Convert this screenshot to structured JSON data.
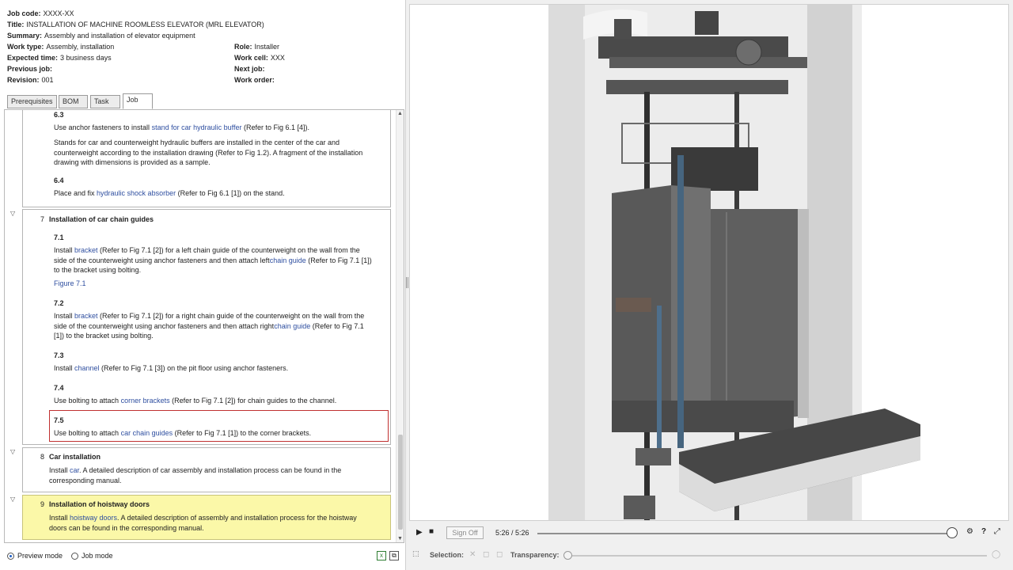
{
  "header": {
    "job_code_label": "Job code:",
    "job_code": "XXXX-XX",
    "title_label": "Title:",
    "title": "INSTALLATION OF MACHINE ROOMLESS ELEVATOR (MRL ELEVATOR)",
    "summary_label": "Summary:",
    "summary": "Assembly and installation of elevator equipment",
    "work_type_label": "Work type:",
    "work_type": "Assembly, installation",
    "expected_time_label": "Expected time:",
    "expected_time": "3 business days",
    "previous_job_label": "Previous job:",
    "revision_label": "Revision:",
    "revision": "001",
    "role_label": "Role:",
    "role": "Installer",
    "work_cell_label": "Work cell:",
    "work_cell": "XXX",
    "next_job_label": "Next job:",
    "work_order_label": "Work order:"
  },
  "tabs": [
    "Prerequisites",
    "BOM",
    "Task",
    "Job"
  ],
  "active_tab": "Job",
  "steps": {
    "step6": {
      "s63_num": "6.3",
      "s63_l1a": "Use anchor fasteners to install ",
      "s63_l1b": "stand for car hydraulic buffer",
      "s63_l1c": " (Refer to Fig 6.1 [4]).",
      "s63_p1": "Stands for car and counterweight hydraulic buffers are installed in the center of the car and",
      "s63_p2": "counterweight according to the installation drawing (Refer to Fig 1.2). A fragment of the installation",
      "s63_p3": "drawing with dimensions is provided as a sample.",
      "s64_num": "6.4",
      "s64_a": "Place and fix ",
      "s64_b": "hydraulic shock absorber",
      "s64_c": " (Refer to Fig 6.1 [1]) on the stand."
    },
    "step7": {
      "number": "7",
      "title": "Installation of car chain guides",
      "s71_num": "7.1",
      "s71_l1a": "Install ",
      "s71_l1b": "bracket",
      "s71_l1c": " (Refer to Fig 7.1 [2]) for a left chain guide of the counterweight on the wall from the",
      "s71_l2a": "side of the counterweight using anchor fasteners and then attach left",
      "s71_l2b": "chain guide",
      "s71_l2c": " (Refer to Fig 7.1 [1])",
      "s71_l3": "to the bracket using bolting.",
      "fig": "Figure 7.1",
      "s72_num": "7.2",
      "s72_l1a": "Install ",
      "s72_l1b": "bracket",
      "s72_l1c": " (Refer to Fig 7.1 [2]) for a right chain guide of the counterweight on the wall from the",
      "s72_l2a": "side of the counterweight using anchor fasteners and then attach right",
      "s72_l2b": "chain guide",
      "s72_l2c": " (Refer to Fig 7.1",
      "s72_l3": "[1]) to the bracket using bolting.",
      "s73_num": "7.3",
      "s73_a": "Install ",
      "s73_b": "channel",
      "s73_c": " (Refer to Fig 7.1 [3]) on the pit floor using anchor fasteners.",
      "s74_num": "7.4",
      "s74_a": "Use bolting to attach ",
      "s74_b": "corner brackets",
      "s74_c": " (Refer to Fig 7.1 [2]) for chain guides to the channel.",
      "s75_num": "7.5",
      "s75_a": "Use bolting to attach ",
      "s75_b": "car chain guides",
      "s75_c": " (Refer to Fig 7.1 [1]) to the corner brackets."
    },
    "step8": {
      "number": "8",
      "title": "Car installation",
      "l1a": "Install ",
      "l1b": "car",
      "l1c": ". A detailed description of car assembly and installation process can be found in the",
      "l2": "corresponding manual."
    },
    "step9": {
      "number": "9",
      "title": "Installation of hoistway doors",
      "l1a": "Install ",
      "l1b": "hoistway doors",
      "l1c": ". A detailed description of assembly and installation process for the hoistway",
      "l2": "doors can be found in the corresponding manual."
    }
  },
  "footer": {
    "preview_mode": "Preview mode",
    "job_mode": "Job mode",
    "selected_mode": "Preview mode"
  },
  "player": {
    "sign_off": "Sign Off",
    "time": "5:26 / 5:26",
    "progress": 1.0
  },
  "selection_bar": {
    "selection_label": "Selection:",
    "transparency_label": "Transparency:",
    "transparency": 0.0
  },
  "colors": {
    "highlight_yellow": "#fbf8a8",
    "link_blue": "#2f4fa0",
    "selected_border": "#c03030"
  }
}
